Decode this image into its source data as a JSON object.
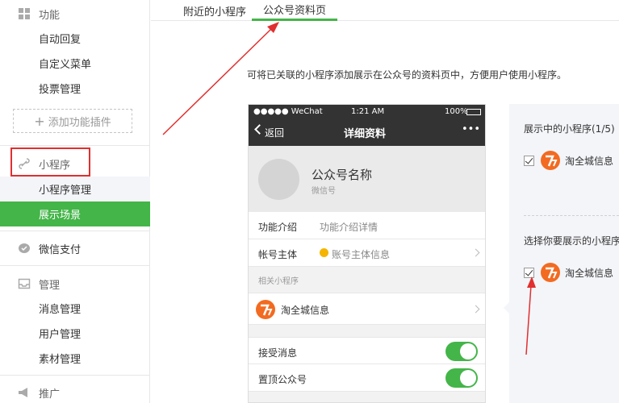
{
  "sidebar": {
    "section_function": "功能",
    "function_items": [
      "自动回复",
      "自定义菜单",
      "投票管理"
    ],
    "add_plugin": "添加功能插件",
    "section_miniprogram": "小程序",
    "miniprogram_items": [
      "小程序管理",
      "展示场景"
    ],
    "section_pay": "微信支付",
    "section_manage": "管理",
    "manage_items": [
      "消息管理",
      "用户管理",
      "素材管理"
    ],
    "section_promo": "推广"
  },
  "tabs": [
    "附近的小程序",
    "公众号资料页"
  ],
  "description": "可将已关联的小程序添加展示在公众号的资料页中，方便用户使用小程序。",
  "phone": {
    "carrier": "●●●●● WeChat",
    "time": "1:21 AM",
    "battery": "100%",
    "back": "返回",
    "title": "详细资料",
    "more": "•••",
    "account_name": "公众号名称",
    "account_sub": "微信号",
    "rows": {
      "intro_key": "功能介绍",
      "intro_val": "功能介绍详情",
      "owner_key": "帐号主体",
      "owner_val": "账号主体信息"
    },
    "related_header": "相关小程序",
    "mini_app": "淘全城信息",
    "toggles": [
      "接受消息",
      "置顶公众号"
    ]
  },
  "panel": {
    "showing_title": "展示中的小程序(1/5)",
    "showing_item": "淘全城信息",
    "select_title": "选择你要展示的小程序",
    "select_item": "淘全城信息"
  },
  "colors": {
    "accent": "#44b549",
    "highlight": "#e0302f",
    "logo": "#f26b21"
  }
}
